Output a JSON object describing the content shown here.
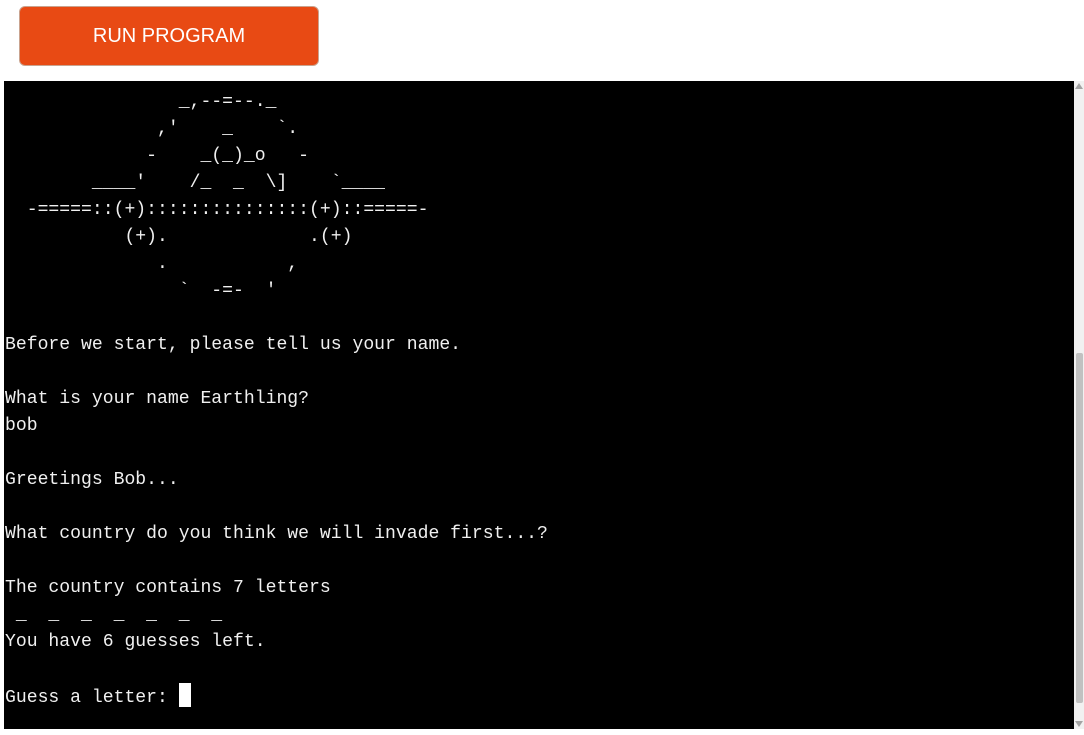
{
  "toolbar": {
    "run_label": "RUN PROGRAM",
    "run_color": "#e84a14"
  },
  "terminal": {
    "background": "#000000",
    "foreground": "#f0f0f0",
    "ascii_art": "                _,--=--._\n              ,'    _    `.\n             -    _(_)_o   -\n        ____'    /_  _  \\]    `____\n  -=====::(+):::::::::::::::(+)::=====-\n           (+).             .(+)\n              .           ,\n                `  -=-  '",
    "lines": [
      "",
      "Before we start, please tell us your name.",
      "",
      "What is your name Earthling?",
      "bob",
      "",
      "Greetings Bob...",
      "",
      "What country do you think we will invade first...?",
      "",
      "The country contains 7 letters",
      " _  _  _  _  _  _  _",
      "You have 6 guesses left.",
      ""
    ],
    "prompt": "Guess a letter: "
  }
}
